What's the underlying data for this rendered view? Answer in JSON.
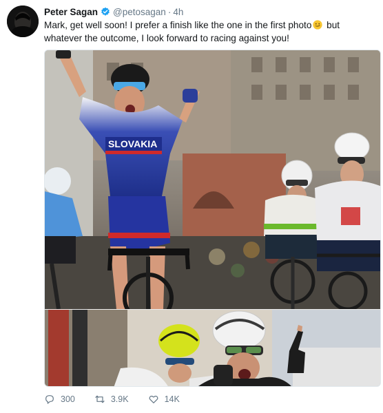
{
  "user": {
    "display_name": "Peter Sagan",
    "handle": "@petosagan",
    "separator": "·",
    "time": "4h"
  },
  "tweet": {
    "text_before_emoji": "Mark, get well soon! I prefer a finish like the one in the first photo",
    "text_after_emoji": " but whatever the outcome, I look forward to racing against you!"
  },
  "photos": {
    "jersey_text": "SLOVAKIA"
  },
  "stats": {
    "replies": "300",
    "retweets": "3.9K",
    "likes": "14K"
  },
  "colors": {
    "verified_blue": "#1da1f2",
    "muted_gray": "#657786"
  }
}
